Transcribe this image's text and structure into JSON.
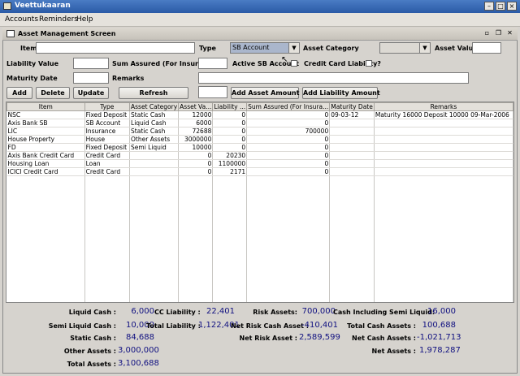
{
  "window": {
    "title": "Veettukaaran"
  },
  "menu": [
    "Accounts",
    "Reminders",
    "Help"
  ],
  "frame": {
    "title": "Asset Management Screen"
  },
  "form": {
    "item_label": "Item",
    "type_label": "Type",
    "type_value": "SB Account",
    "asset_category_label": "Asset Category",
    "asset_category_value": "",
    "asset_value_label": "Asset Value",
    "liability_value_label": "Liability Value",
    "sum_assured_label": "Sum Assured (For Insurance)",
    "active_sb_label": "Active SB Account",
    "credit_card_label": "Credit Card Liability?",
    "maturity_date_label": "Maturity Date",
    "remarks_label": "Remarks"
  },
  "buttons": {
    "add": "Add",
    "delete": "Delete",
    "update": "Update",
    "refresh": "Refresh",
    "add_asset_amount": "Add Asset Amount",
    "add_liability_amount": "Add Liability Amount"
  },
  "table": {
    "columns": [
      "Item",
      "Type",
      "Asset Category",
      "Asset Va...",
      "Liability ...",
      "Sum Assured (For Insura...",
      "Maturity Date",
      "Remarks"
    ],
    "rows": [
      [
        "NSC",
        "Fixed Deposit",
        "Static Cash",
        "12000",
        "0",
        "0",
        "09-03-12",
        "Maturity 16000 Deposit 10000 09-Mar-2006"
      ],
      [
        "Axis Bank SB",
        "SB Account",
        "Liquid Cash",
        "6000",
        "0",
        "0",
        "",
        ""
      ],
      [
        "LIC",
        "Insurance",
        "Static Cash",
        "72688",
        "0",
        "700000",
        "",
        ""
      ],
      [
        "House Property",
        "House",
        "Other Assets",
        "3000000",
        "0",
        "0",
        "",
        ""
      ],
      [
        "FD",
        "Fixed Deposit",
        "Semi Liquid",
        "10000",
        "0",
        "0",
        "",
        ""
      ],
      [
        "Axis Bank Credit Card",
        "Credit Card",
        "",
        "0",
        "20230",
        "0",
        "",
        ""
      ],
      [
        "Housing Loan",
        "Loan",
        "",
        "0",
        "1100000",
        "0",
        "",
        ""
      ],
      [
        "ICICI Credit Card",
        "Credit Card",
        "",
        "0",
        "2171",
        "0",
        "",
        ""
      ]
    ]
  },
  "summary": {
    "liquid_cash": {
      "label": "Liquid Cash :",
      "value": "6,000"
    },
    "semi_liquid_cash": {
      "label": "Semi Liquid Cash :",
      "value": "10,000"
    },
    "static_cash": {
      "label": "Static Cash :",
      "value": "84,688"
    },
    "other_assets": {
      "label": "Other Assets :",
      "value": "3,000,000"
    },
    "total_assets": {
      "label": "Total Assets :",
      "value": "3,100,688"
    },
    "cc_liability": {
      "label": "CC Liability :",
      "value": "22,401"
    },
    "total_liability": {
      "label": "Total Liability :",
      "value": "1,122,401"
    },
    "risk_assets": {
      "label": "Risk Assets:",
      "value": "700,000"
    },
    "net_risk_cash_asset": {
      "label": "Net Risk Cash Asset :",
      "value": "-410,401"
    },
    "net_risk_asset": {
      "label": "Net Risk Asset :",
      "value": "2,589,599"
    },
    "cash_incl_semi_liquid": {
      "label": "Cash Including Semi Liquid:",
      "value": "16,000"
    },
    "total_cash_assets": {
      "label": "Total Cash Assets :",
      "value": "100,688"
    },
    "net_cash_assets": {
      "label": "Net Cash Assets :",
      "value": "-1,021,713"
    },
    "net_assets": {
      "label": "Net Assets :",
      "value": "1,978,287"
    }
  },
  "colors": {
    "titlebar": "#2a5aa6",
    "summary_value": "#101080",
    "combo_selected": "#aab6cc"
  }
}
